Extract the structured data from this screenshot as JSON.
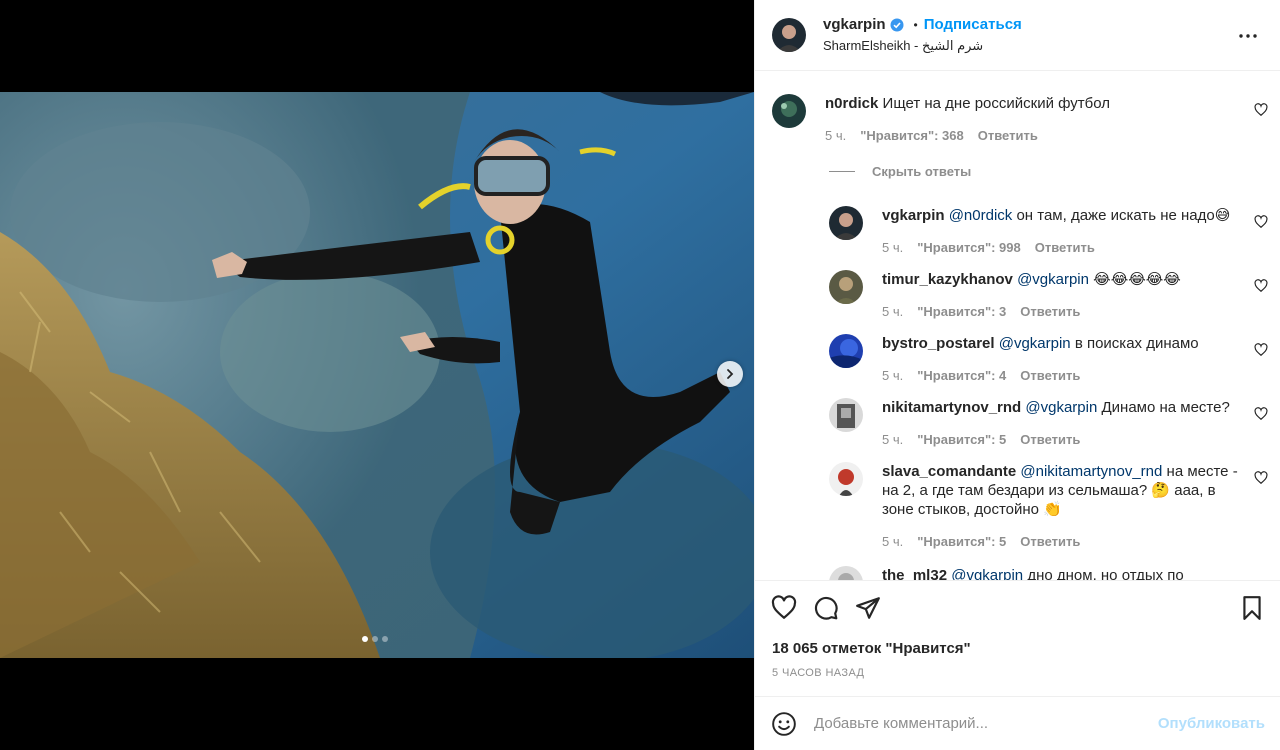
{
  "post": {
    "username": "vgkarpin",
    "separator": "•",
    "follow_label": "Подписаться",
    "location": "SharmElsheikh - شرم الشيخ",
    "likes": "18 065 отметок \"Нравится\"",
    "time_ago": "5 ЧАСОВ НАЗАД",
    "media_dots": 3,
    "active_dot": 0
  },
  "comments": {
    "hide_replies_label": "Скрыть ответы",
    "items": [
      {
        "user": "n0rdick",
        "mention": "",
        "text": "Ищет на дне российский футбол",
        "time": "5 ч.",
        "likes": "\"Нравится\": 368",
        "reply": "Ответить"
      },
      {
        "user": "vgkarpin",
        "mention": "@n0rdick",
        "text": "он там, даже искать не надо😅",
        "time": "5 ч.",
        "likes": "\"Нравится\": 998",
        "reply": "Ответить"
      },
      {
        "user": "timur_kazykhanov",
        "mention": "@vgkarpin",
        "text": "😂😂😂😂😂",
        "time": "5 ч.",
        "likes": "\"Нравится\": 3",
        "reply": "Ответить"
      },
      {
        "user": "bystro_postarel",
        "mention": "@vgkarpin",
        "text": "в поисках динамо",
        "time": "5 ч.",
        "likes": "\"Нравится\": 4",
        "reply": "Ответить"
      },
      {
        "user": "nikitamartynov_rnd",
        "mention": "@vgkarpin",
        "text": "Динамо на месте?",
        "time": "5 ч.",
        "likes": "\"Нравится\": 5",
        "reply": "Ответить"
      },
      {
        "user": "slava_comandante",
        "mention": "@nikitamartynov_rnd",
        "text": "на месте - на 2, а где там бездари из сельмаша? 🤔 ааа, в зоне стыков, достойно 👏",
        "time": "5 ч.",
        "likes": "\"Нравится\": 5",
        "reply": "Ответить"
      },
      {
        "user": "the_ml32",
        "mention": "@vgkarpin",
        "text": "дно дном, но отдых по",
        "time": "",
        "likes": "",
        "reply": ""
      }
    ]
  },
  "composer": {
    "placeholder": "Добавьте комментарий...",
    "publish_label": "Опубликовать"
  },
  "icons": {
    "verified": "verified-badge-icon",
    "more": "more-options-icon",
    "like": "heart-icon",
    "comment": "comment-bubble-icon",
    "share": "paper-plane-icon",
    "save": "bookmark-icon",
    "emoji": "emoji-icon",
    "next": "chevron-right-icon"
  },
  "colors": {
    "accent": "#0095f6",
    "publish_disabled": "#b2dffc",
    "muted": "#8e8e8e",
    "mention": "#00376b"
  }
}
